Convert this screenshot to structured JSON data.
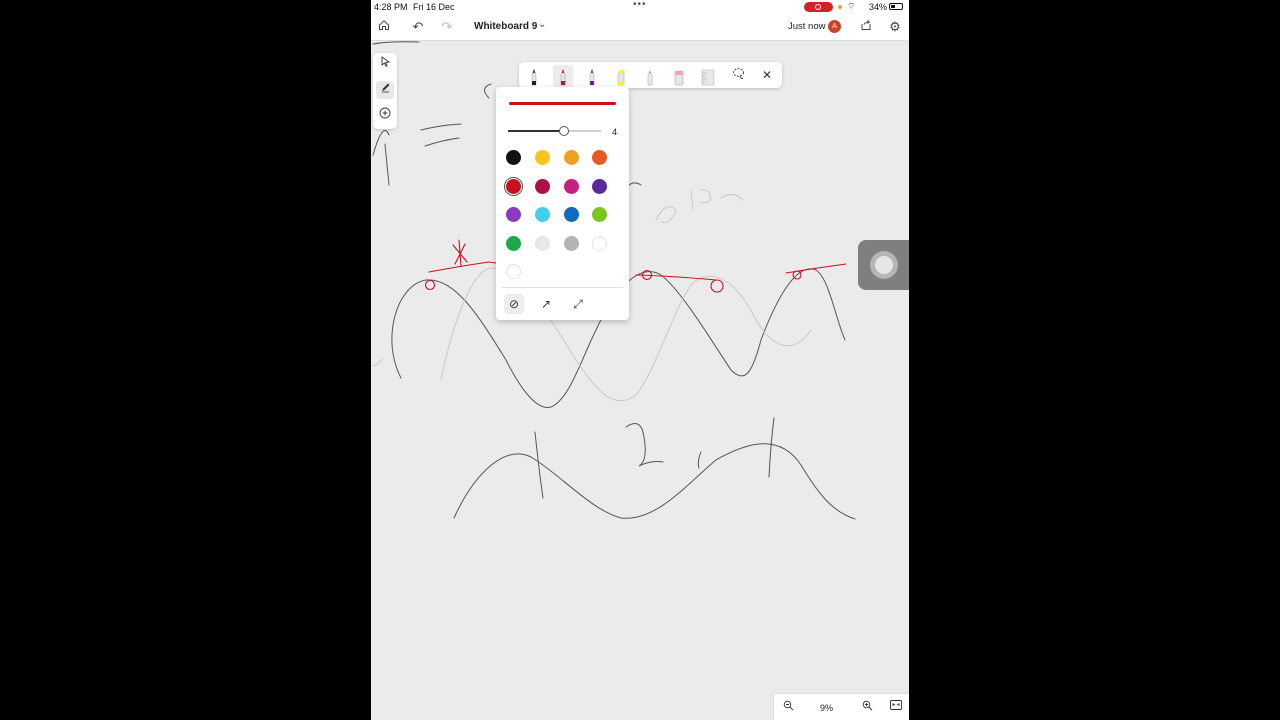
{
  "status_bar": {
    "time": "4:28 PM",
    "date": "Fri 16 Dec",
    "battery": "34%"
  },
  "app_bar": {
    "title": "Whiteboard 9",
    "sync_status": "Just now",
    "avatar_initial": "A"
  },
  "pen_settings": {
    "stroke_size": "4",
    "stroke_size_fraction": 0.6,
    "selected_color": "#c8101e",
    "colors": [
      {
        "name": "black",
        "hex": "#111111"
      },
      {
        "name": "yellow",
        "hex": "#f5c518"
      },
      {
        "name": "amber",
        "hex": "#f0a020"
      },
      {
        "name": "orange",
        "hex": "#e85a25"
      },
      {
        "name": "red",
        "hex": "#c8101e",
        "selected": true
      },
      {
        "name": "crimson",
        "hex": "#b01044"
      },
      {
        "name": "magenta",
        "hex": "#c71f7f"
      },
      {
        "name": "purple",
        "hex": "#5a2a9a"
      },
      {
        "name": "violet",
        "hex": "#8a3ac0"
      },
      {
        "name": "cyan",
        "hex": "#3fcfef"
      },
      {
        "name": "blue",
        "hex": "#0f6ac0"
      },
      {
        "name": "lime",
        "hex": "#7ac61e"
      },
      {
        "name": "green",
        "hex": "#1fa84a"
      },
      {
        "name": "light-gray",
        "hex": "#e8e8e8"
      },
      {
        "name": "gray",
        "hex": "#b3b3b3"
      },
      {
        "name": "white",
        "hex": "#ffffff"
      },
      {
        "name": "white-2",
        "hex": "#ffffff"
      }
    ],
    "line_caps": [
      "no-arrow-icon",
      "arrow-end-icon",
      "arrow-both-icon"
    ]
  },
  "pen_tray": {
    "pens": [
      {
        "name": "black-pen",
        "color": "#222222"
      },
      {
        "name": "red-pen",
        "color": "#c8101e",
        "selected": true
      },
      {
        "name": "purple-pen",
        "color": "#5a2a9a"
      },
      {
        "name": "highlighter",
        "color": "#f2f23a"
      },
      {
        "name": "red-tip-pen",
        "color": "#e85a5a"
      },
      {
        "name": "eraser",
        "color": "#f4a0b0"
      },
      {
        "name": "ruler",
        "color": "#cccccc"
      }
    ]
  },
  "zoom": {
    "level": "9%"
  },
  "colors": {
    "accent": "#c8101e",
    "canvas": "#ebebeb"
  }
}
